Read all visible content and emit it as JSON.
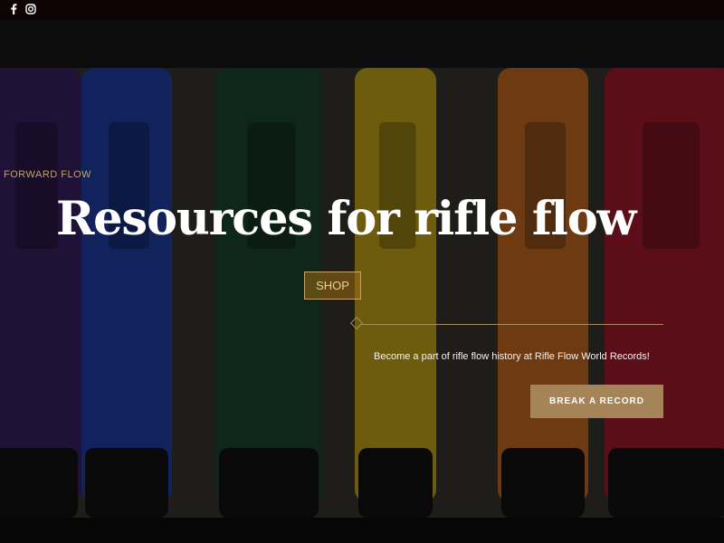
{
  "topbar": {
    "social": [
      {
        "icon": "facebook-icon",
        "glyph": "f"
      },
      {
        "icon": "instagram-icon"
      }
    ]
  },
  "hero": {
    "background_image": "rifle-flow-bags-photo",
    "bag_colors": [
      "#3b1f63",
      "#1f3ea8",
      "#1d4630",
      "#c9a81a",
      "#c66a22",
      "#a81b2c"
    ],
    "eyebrow": "FORWARD FLOW",
    "headline": "Resources for rifle flow",
    "shop_label": "SHOP",
    "tagline": "Become a part of rifle flow history at Rifle Flow World Records!",
    "cta_label": "BREAK A RECORD"
  },
  "colors": {
    "accent": "#c5a46a",
    "cta": "#a5845a",
    "topbar": "#0d0305"
  }
}
